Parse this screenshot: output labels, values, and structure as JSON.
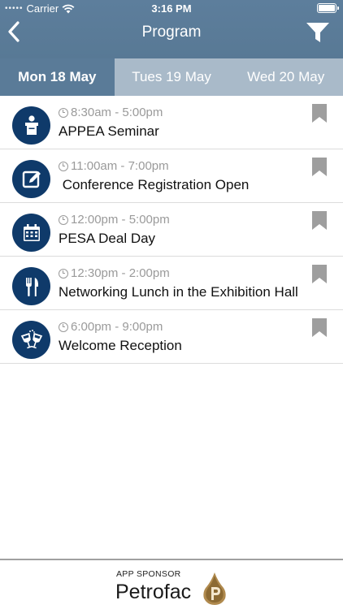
{
  "status_bar": {
    "dots": "•••••",
    "carrier": "Carrier",
    "time": "3:16 PM"
  },
  "header": {
    "title": "Program"
  },
  "tabs": [
    {
      "label": "Mon 18 May",
      "active": true
    },
    {
      "label": "Tues 19 May",
      "active": false
    },
    {
      "label": "Wed 20 May",
      "active": false
    }
  ],
  "events": [
    {
      "time": "8:30am - 5:00pm",
      "title": "APPEA Seminar",
      "icon": "speaker-podium-icon"
    },
    {
      "time": "11:00am - 7:00pm",
      "title": " Conference Registration Open",
      "icon": "edit-form-icon"
    },
    {
      "time": "12:00pm - 5:00pm",
      "title": "PESA Deal Day",
      "icon": "calendar-icon"
    },
    {
      "time": "12:30pm - 2:00pm",
      "title": "Networking Lunch in the Exhibition Hall",
      "icon": "fork-knife-icon"
    },
    {
      "time": "6:00pm - 9:00pm",
      "title": "Welcome Reception",
      "icon": "cheers-glasses-icon"
    }
  ],
  "footer": {
    "sponsor_label": "APP SPONSOR",
    "sponsor_name": "Petrofac"
  },
  "colors": {
    "header": "#5d7e9c",
    "tab_active": "#5a7b98",
    "tab_inactive": "#a9bac9",
    "icon_bg": "#0f3a6a"
  }
}
